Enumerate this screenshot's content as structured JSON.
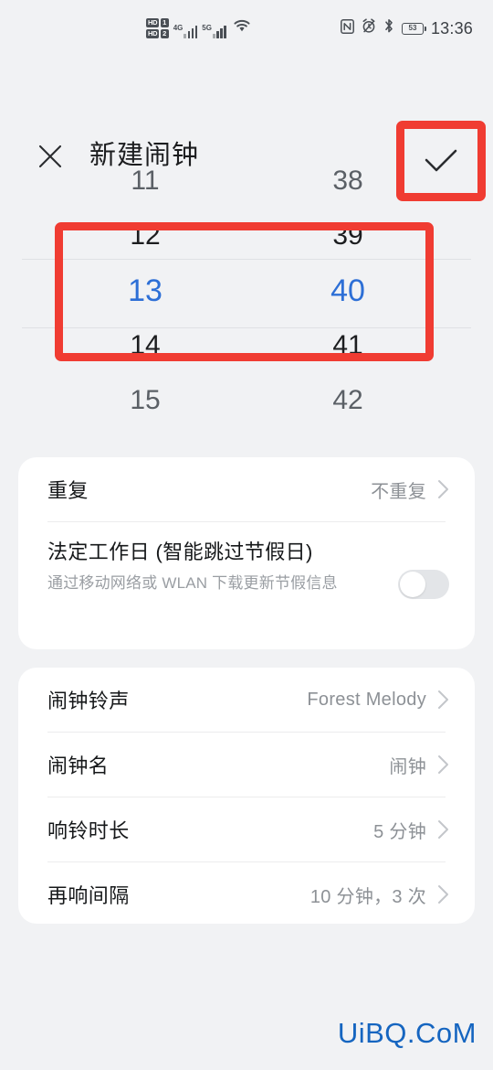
{
  "status_bar": {
    "hd_badge_1": "HD",
    "hd_badge_2": "HD",
    "sim_1": "1",
    "sim_2": "2",
    "network_1": "4G",
    "network_2": "5G",
    "wifi_icon": "wifi-icon",
    "nfc_icon": "nfc-icon",
    "alarm_icon": "alarm-muted-icon",
    "bluetooth_icon": "bluetooth-icon",
    "battery_level": "53",
    "time": "13:36"
  },
  "header": {
    "close_icon": "close-icon",
    "title": "新建闹钟",
    "confirm_icon": "check-icon"
  },
  "time_picker": {
    "hours": [
      "11",
      "12",
      "13",
      "14",
      "15"
    ],
    "minutes": [
      "38",
      "39",
      "40",
      "41",
      "42"
    ],
    "selected_hour": "13",
    "selected_minute": "40",
    "selected_color": "#2d6fd6",
    "highlight_color": "#f03c32"
  },
  "card_repeat": {
    "repeat_label": "重复",
    "repeat_value": "不重复",
    "workday_title": "法定工作日 (智能跳过节假日)",
    "workday_subtitle": "通过移动网络或 WLAN 下载更新节假信息",
    "workday_toggle": "off"
  },
  "card_settings": {
    "rows": [
      {
        "label": "闹钟铃声",
        "value": "Forest Melody"
      },
      {
        "label": "闹钟名",
        "value": "闹钟"
      },
      {
        "label": "响铃时长",
        "value": "5 分钟"
      },
      {
        "label": "再响间隔",
        "value": "10 分钟，3 次"
      }
    ]
  },
  "watermark": {
    "text": "UiBQ.CoM",
    "color": "#1565c0"
  }
}
